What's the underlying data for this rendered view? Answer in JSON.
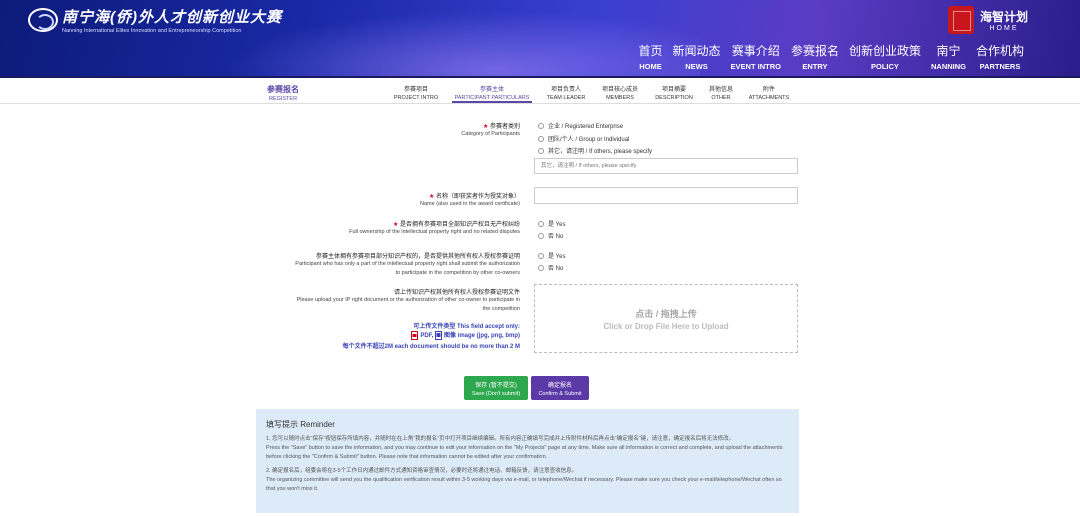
{
  "header": {
    "logo_cn": "南宁海(侨)外人才创新创业大赛",
    "logo_en": "Nanning International Elites Innovation and Entrepreneurship Competition",
    "brand_cn": "海智计划",
    "brand_en": "HOME",
    "nav": [
      {
        "cn": "首页",
        "en": "HOME"
      },
      {
        "cn": "新闻动态",
        "en": "NEWS"
      },
      {
        "cn": "赛事介绍",
        "en": "EVENT INTRO"
      },
      {
        "cn": "参赛报名",
        "en": "ENTRY"
      },
      {
        "cn": "创新创业政策",
        "en": "POLICY"
      },
      {
        "cn": "南宁",
        "en": "NANNING"
      },
      {
        "cn": "合作机构",
        "en": "PARTNERS"
      }
    ]
  },
  "tabs": {
    "register": {
      "cn": "参赛报名",
      "en": "REGISTER"
    },
    "items": [
      {
        "cn": "参赛项目",
        "en": "PROJECT INTRO"
      },
      {
        "cn": "参赛主体",
        "en": "PARTICIPANT PARTICULARS"
      },
      {
        "cn": "项目负责人",
        "en": "TEAM LEADER"
      },
      {
        "cn": "项目核心成员",
        "en": "MEMBERS"
      },
      {
        "cn": "项目摘要",
        "en": "DESCRIPTION"
      },
      {
        "cn": "其他信息",
        "en": "OTHER"
      },
      {
        "cn": "附件",
        "en": "ATTACHMENTS"
      }
    ],
    "active_index": 1
  },
  "form": {
    "category": {
      "label_cn": "参赛者类别",
      "label_en": "Category of Participants",
      "options": [
        "企业 / Registered Enterprise",
        "团队/个人 / Group or Individual",
        "其它，请注明 / If others, please specify"
      ],
      "other_placeholder": "其它，请注明 / If others, please specify"
    },
    "name": {
      "label_cn": "名称（即获奖者作为授奖对象）",
      "label_en": "Name (also used in the award certificate)",
      "value": ""
    },
    "ownership": {
      "label_cn": "是否拥有参赛项目全部知识产权且无产权纠纷",
      "label_en": "Full ownership of the intellectual property right and no related disputes",
      "options": [
        "是 Yes",
        "否 No"
      ]
    },
    "authorization": {
      "label_cn": "参赛主体拥有参赛项目部分知识产权的，是否提供其他所有权人授权参赛证明",
      "label_en_1": "Participant who has only a part of the intellectual property right shall submit the authorization",
      "label_en_2": "to participate in the competition by other co-owners",
      "options": [
        "是 Yes",
        "否 No"
      ]
    },
    "upload": {
      "label_cn": "请上传知识产权其他所有权人授权参赛证明文件",
      "label_en_1": "Please upload your IP right document or the authorization of other co-owner to participate in",
      "label_en_2": "the competition",
      "drop_cn": "点击 / 拖拽上传",
      "drop_en": "Click or Drop File Here to Upload",
      "accept_label": "可上传文件类型 This field accept only:",
      "pdf_label": "PDF,",
      "image_label": "图像 image (jpg, png, bmp)",
      "size_label": "每个文件不超过2M   each document should be no more than 2 M"
    }
  },
  "buttons": {
    "save_cn": "保存 (暂不提交)",
    "save_en": "Save (Don't submit)",
    "submit_cn": "确定报名",
    "submit_en": "Confirm & Submit"
  },
  "reminder": {
    "title": "填写提示 Reminder",
    "items": [
      {
        "cn": "1. 您可以随时点击“保存”按钮保存所填内容，并随时在在上角“我的报名”页中打开项目继续编辑。所有内容正确填写完成并上传附件材料后再点击“确定报名”键，请注意，确定报名后将无法修改。",
        "en": "Press the \"Save\" button to save the information, and you may continue to edit your information on the \"My Projects\" page at any time. Make sure all information is correct and complete, and upload the attachments before clicking the \"Confirm & Submit\" button. Please note that information cannot be edited after your confirmation."
      },
      {
        "cn": "2. 确定报名后，组委会将在3-5个工作日内通过邮件方式通知资格审查情况，必要时还将通过电话、邮箱反馈，请注意查收信息。",
        "en": "The organizing committee will send you the qualification verification result within 3-5 working days via e-mail, or telephone/Wechat if necessary. Please make sure you check your e-mail/telephone/Wechat often so that you won't miss it."
      }
    ]
  },
  "colors": {
    "accent": "#5b49a8",
    "required": "#d0021b",
    "save_button": "#2ea84f",
    "submit_button": "#5b3aa8",
    "reminder_bg": "#dcebf7"
  }
}
